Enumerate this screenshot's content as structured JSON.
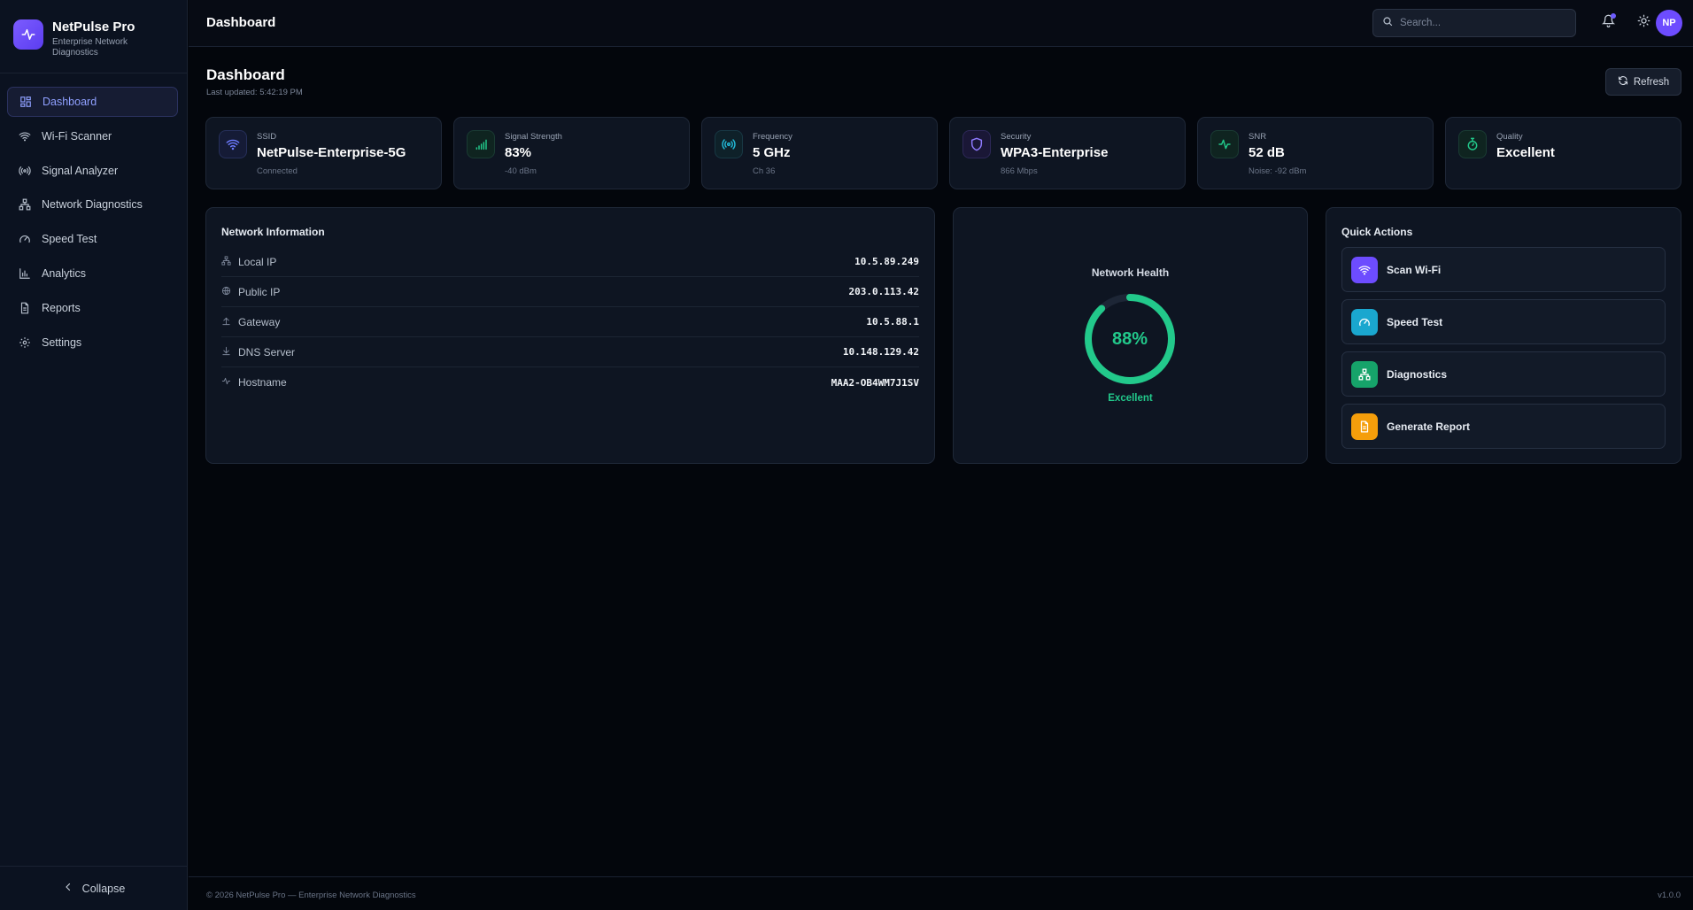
{
  "brand": {
    "name": "NetPulse Pro",
    "subtitle": "Enterprise Network Diagnostics"
  },
  "sidebar": {
    "items": [
      {
        "label": "Dashboard",
        "icon": "dashboard-grid-icon",
        "active": true
      },
      {
        "label": "Wi-Fi Scanner",
        "icon": "wifi-icon"
      },
      {
        "label": "Signal Analyzer",
        "icon": "signal-radio-icon"
      },
      {
        "label": "Network Diagnostics",
        "icon": "network-icon"
      },
      {
        "label": "Speed Test",
        "icon": "speedometer-icon"
      },
      {
        "label": "Analytics",
        "icon": "bar-chart-icon"
      },
      {
        "label": "Reports",
        "icon": "document-icon"
      },
      {
        "label": "Settings",
        "icon": "gear-icon"
      }
    ],
    "collapse_label": "Collapse"
  },
  "header": {
    "title": "Dashboard",
    "search_placeholder": "Search...",
    "avatar_initials": "NP"
  },
  "main": {
    "title": "Dashboard",
    "last_updated": "Last updated: 5:42:19 PM",
    "refresh_label": "Refresh"
  },
  "stats": [
    {
      "label": "SSID",
      "value": "NetPulse-Enterprise-5G",
      "sub": "Connected",
      "icon": "wifi-icon",
      "color": "#6d7bff"
    },
    {
      "label": "Signal Strength",
      "value": "83%",
      "sub": "-40 dBm",
      "icon": "signal-bars-icon",
      "color": "#22c98b"
    },
    {
      "label": "Frequency",
      "value": "5 GHz",
      "sub": "Ch 36",
      "icon": "radio-waves-icon",
      "color": "#22b8d6"
    },
    {
      "label": "Security",
      "value": "WPA3-Enterprise",
      "sub": "866 Mbps",
      "icon": "shield-icon",
      "color": "#8f7bff"
    },
    {
      "label": "SNR",
      "value": "52 dB",
      "sub": "Noise: -92 dBm",
      "icon": "activity-icon",
      "color": "#22c98b"
    },
    {
      "label": "Quality",
      "value": "Excellent",
      "sub": "",
      "icon": "stopwatch-icon",
      "color": "#22c98b"
    }
  ],
  "network_info": {
    "title": "Network Information",
    "rows": [
      {
        "label": "Local IP",
        "value": "10.5.89.249",
        "icon": "network-icon"
      },
      {
        "label": "Public IP",
        "value": "203.0.113.42",
        "icon": "globe-icon"
      },
      {
        "label": "Gateway",
        "value": "10.5.88.1",
        "icon": "upload-arrow-icon"
      },
      {
        "label": "DNS Server",
        "value": "10.148.129.42",
        "icon": "download-arrow-icon"
      },
      {
        "label": "Hostname",
        "value": "MAA2-OB4WM7J1SV",
        "icon": "activity-icon"
      }
    ]
  },
  "health": {
    "title": "Network Health",
    "percent": 88,
    "percent_label": "88%",
    "status": "Excellent",
    "color": "#22c98b"
  },
  "quick_actions": {
    "title": "Quick Actions",
    "items": [
      {
        "label": "Scan Wi-Fi",
        "icon": "wifi-icon",
        "color": "#6d4cff"
      },
      {
        "label": "Speed Test",
        "icon": "speedometer-icon",
        "color": "#1aa7cf"
      },
      {
        "label": "Diagnostics",
        "icon": "network-icon",
        "color": "#16a36a"
      },
      {
        "label": "Generate Report",
        "icon": "document-icon",
        "color": "#f59e0b"
      }
    ]
  },
  "footer": {
    "copyright": "© 2026 NetPulse Pro — Enterprise Network Diagnostics",
    "version": "v1.0.0"
  }
}
